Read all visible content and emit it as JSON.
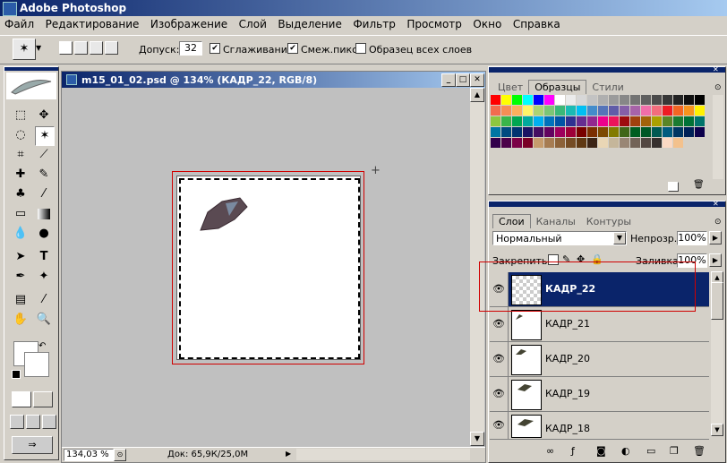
{
  "app": {
    "title": "Adobe Photoshop"
  },
  "menu": [
    "Файл",
    "Редактирование",
    "Изображение",
    "Слой",
    "Выделение",
    "Фильтр",
    "Просмотр",
    "Окно",
    "Справка"
  ],
  "options": {
    "tolerance_label": "Допуск:",
    "tolerance_value": "32",
    "antialias_label": "Сглаживание",
    "contiguous_label": "Смеж.пикс",
    "sample_all_label": "Образец всех слоев",
    "antialias_checked": true,
    "contiguous_checked": true,
    "sample_all_checked": false
  },
  "document": {
    "title": "m15_01_02.psd @ 134% (КАДР_22, RGB/8)",
    "zoom": "134,03 %",
    "doc_size": "Док: 65,9К/25,0М"
  },
  "swatches_panel": {
    "tabs": [
      "Цвет",
      "Образцы",
      "Стили"
    ],
    "active_tab": "Образцы",
    "colors": [
      "#ff0000",
      "#ffff00",
      "#00ff00",
      "#00ffff",
      "#0000ff",
      "#ff00ff",
      "#ffffff",
      "#ebebeb",
      "#d7d7d7",
      "#c3c3c3",
      "#afafaf",
      "#9b9b9b",
      "#878787",
      "#737373",
      "#5f5f5f",
      "#4b4b4b",
      "#373737",
      "#232323",
      "#0f0f0f",
      "#000000",
      "#f26c4f",
      "#f68e55",
      "#fbaf5d",
      "#fff467",
      "#acd372",
      "#7cc576",
      "#3bb878",
      "#1abbb4",
      "#00bff3",
      "#438ccb",
      "#5574b9",
      "#605ca8",
      "#855fa8",
      "#a763a8",
      "#f06ea9",
      "#f26d7d",
      "#ed1c24",
      "#f26522",
      "#f7941d",
      "#fff200",
      "#8dc73f",
      "#39b54a",
      "#00a651",
      "#00a99d",
      "#00aeef",
      "#0072bc",
      "#0054a6",
      "#2e3192",
      "#662d91",
      "#92278f",
      "#ec008c",
      "#ed145b",
      "#9e0b0f",
      "#a0410d",
      "#a3620a",
      "#aba000",
      "#598527",
      "#1a7b30",
      "#007236",
      "#00746b",
      "#0076a3",
      "#004b80",
      "#003471",
      "#1b1464",
      "#440e62",
      "#630460",
      "#9e005d",
      "#9e0039",
      "#790000",
      "#7b2e00",
      "#7d4900",
      "#827b00",
      "#406618",
      "#005e20",
      "#005826",
      "#005952",
      "#005b7f",
      "#003663",
      "#002157",
      "#0d004c",
      "#32004b",
      "#4b0049",
      "#7b0046",
      "#7a0026",
      "#c69c6d",
      "#a67c52",
      "#8c6239",
      "#754c24",
      "#603913",
      "#3c2415",
      "#e9d6b5",
      "#c5b69a",
      "#998675",
      "#736357",
      "#534741",
      "#362f2d",
      "#fbd9c4",
      "#f3c18d"
    ]
  },
  "layers_panel": {
    "tabs": [
      "Слои",
      "Каналы",
      "Контуры"
    ],
    "active_tab": "Слои",
    "blend_mode": "Нормальный",
    "opacity_label": "Непрозр.:",
    "opacity": "100%",
    "lock_label": "Закрепить:",
    "fill_label": "Заливка:",
    "fill": "100%",
    "layers": [
      {
        "name": "КАДР_22",
        "selected": true
      },
      {
        "name": "КАДР_21",
        "selected": false
      },
      {
        "name": "КАДР_20",
        "selected": false
      },
      {
        "name": "КАДР_19",
        "selected": false
      },
      {
        "name": "КАДР_18",
        "selected": false
      }
    ]
  }
}
